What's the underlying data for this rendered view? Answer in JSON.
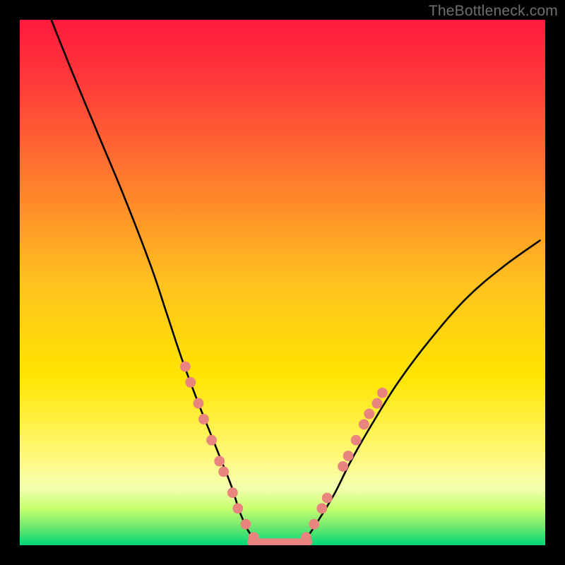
{
  "watermark": "TheBottleneck.com",
  "chart_data": {
    "type": "line",
    "title": "",
    "xlabel": "",
    "ylabel": "",
    "xlim": [
      0,
      100
    ],
    "ylim": [
      0,
      100
    ],
    "grid": false,
    "background_gradient": {
      "top": "#ff1a3d",
      "mid": "#ffe500",
      "green_band_top": "#c8ff70",
      "green_band_bottom": "#00e57a"
    },
    "series": [
      {
        "name": "curve",
        "color": "#000000",
        "x": [
          6,
          10,
          15,
          20,
          25,
          28,
          31,
          34,
          36,
          38,
          40,
          41,
          42,
          44,
          47,
          50,
          53,
          55,
          57,
          60,
          63,
          67,
          72,
          78,
          85,
          92,
          99
        ],
        "y": [
          100,
          90,
          78,
          66,
          53,
          44,
          35,
          27,
          22,
          17,
          12,
          9,
          6,
          2,
          0,
          0,
          0,
          2,
          5,
          10,
          16,
          23,
          31,
          39,
          47,
          53,
          58
        ]
      }
    ],
    "flat_segment": {
      "x0": 44,
      "x1": 55,
      "y": 0,
      "color": "#e9847f"
    },
    "markers": {
      "color": "#e9847f",
      "radius": 1.0,
      "points": [
        {
          "x": 31.5,
          "y": 34
        },
        {
          "x": 32.5,
          "y": 31
        },
        {
          "x": 34.0,
          "y": 27
        },
        {
          "x": 35.0,
          "y": 24
        },
        {
          "x": 36.5,
          "y": 20
        },
        {
          "x": 38.0,
          "y": 16
        },
        {
          "x": 38.8,
          "y": 14
        },
        {
          "x": 40.5,
          "y": 10
        },
        {
          "x": 41.5,
          "y": 7
        },
        {
          "x": 43.0,
          "y": 4
        },
        {
          "x": 44.5,
          "y": 1.5
        },
        {
          "x": 54.5,
          "y": 1.5
        },
        {
          "x": 56.0,
          "y": 4
        },
        {
          "x": 57.5,
          "y": 7
        },
        {
          "x": 58.5,
          "y": 9
        },
        {
          "x": 61.5,
          "y": 15
        },
        {
          "x": 62.5,
          "y": 17
        },
        {
          "x": 64.0,
          "y": 20
        },
        {
          "x": 65.5,
          "y": 23
        },
        {
          "x": 66.5,
          "y": 25
        },
        {
          "x": 68.0,
          "y": 27
        },
        {
          "x": 69.0,
          "y": 29
        }
      ]
    }
  }
}
